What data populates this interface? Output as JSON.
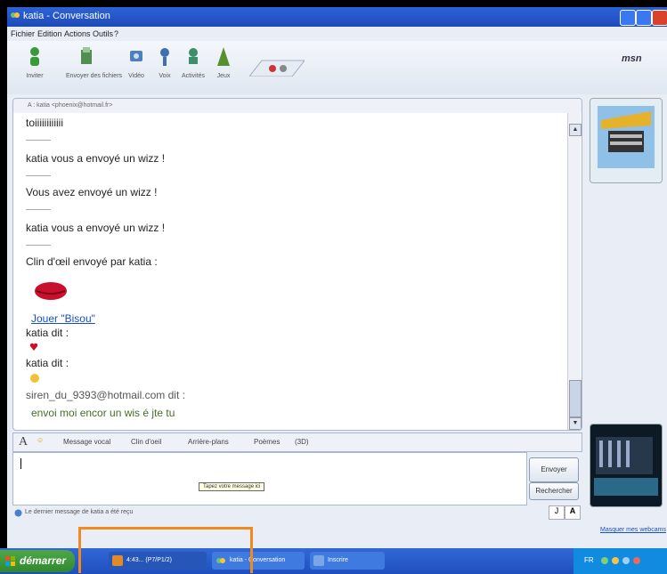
{
  "window": {
    "title": "katia - Conversation",
    "menu": [
      "Fichier",
      "Edition",
      "Actions",
      "Outils",
      "?"
    ],
    "brand": "msn"
  },
  "toolbar": {
    "items": [
      {
        "label": "Inviter",
        "icon": "invite-icon"
      },
      {
        "label": "Envoyer des fichiers",
        "icon": "send-files-icon"
      },
      {
        "label": "Vidéo",
        "icon": "video-icon"
      },
      {
        "label": "Voix",
        "icon": "voice-icon"
      },
      {
        "label": "Activités",
        "icon": "activities-icon"
      },
      {
        "label": "Jeux",
        "icon": "games-icon"
      }
    ]
  },
  "conversation": {
    "to": "A : katia <phoenix@hotmail.fr>",
    "messages": [
      {
        "text": "toiiiiiiiiiiii"
      },
      {
        "text": "katia vous a envoyé un wizz !"
      },
      {
        "text": "Vous avez envoyé un wizz !"
      },
      {
        "text": "katia vous a envoyé un wizz !"
      },
      {
        "text": "Clin d'œil envoyé par katia :"
      },
      {
        "text": "Jouer \"Bisou\""
      },
      {
        "text": "katia dit :"
      },
      {
        "text": "katia dit :"
      },
      {
        "text": "siren_du_9393@hotmail.com dit :"
      },
      {
        "text": "envoi moi encor un wis é jte tu"
      }
    ]
  },
  "format_bar": {
    "items": [
      "A",
      "Message vocal",
      "Clin d'oeil",
      "Arrière-plans",
      "Poèmes",
      "(3D)"
    ]
  },
  "input": {
    "tooltip": "Tapez votre message ici",
    "send_label": "Envoyer",
    "search_label": "Rechercher"
  },
  "status": {
    "text": "Le dernier message de katia a été reçu"
  },
  "sidebar": {
    "link": "Masquer mes webcams"
  },
  "taskbar": {
    "start_label": "démarrer",
    "tasks": [
      "4:43... (P7/P1/2)",
      "katia - Conversation",
      "Inscrire"
    ],
    "tray_text": "FR"
  },
  "colors": {
    "title_bar": "#2d63d8",
    "taskbar": "#1f4fbe",
    "start_button": "#3a9a36",
    "highlight_box": "#f08a1e",
    "link": "#1a4fc4"
  }
}
